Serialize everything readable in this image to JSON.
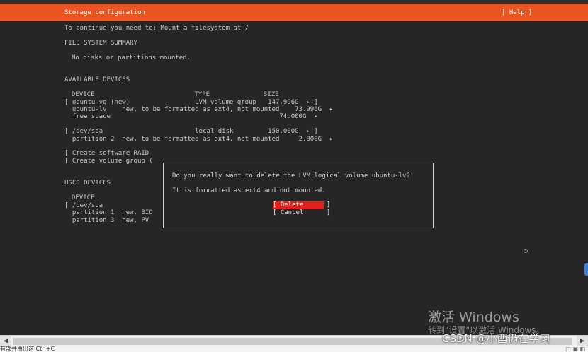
{
  "header": {
    "title": "Storage configuration",
    "help": "[ Help ]"
  },
  "intro": "To continue you need to: Mount a filesystem at /",
  "summary": {
    "heading": "FILE SYSTEM SUMMARY",
    "empty": "No disks or partitions mounted."
  },
  "available": {
    "heading": "AVAILABLE DEVICES",
    "columns": "DEVICE                          TYPE              SIZE",
    "rows": [
      "[ ubuntu-vg (new)                 LVM volume group   147.996G  ▸ ]",
      "  ubuntu-lv    new, to be formatted as ext4, not mounted    73.996G  ▸",
      "  free space                                            74.000G  ▸",
      "[ /dev/sda                        local disk         150.000G  ▸ ]",
      "  partition 2  new, to be formatted as ext4, not mounted     2.000G  ▸"
    ],
    "actions": [
      "[ Create software RAID",
      "[ Create volume group ("
    ]
  },
  "used": {
    "heading": "USED DEVICES",
    "columns": "DEVICE",
    "rows": [
      "[ /dev/sda",
      "  partition 1  new, BIO",
      "  partition 3  new, PV"
    ]
  },
  "dialog": {
    "question": "Do you really want to delete the LVM logical volume ubuntu-lv?",
    "detail": "It is formatted as ext4 and not mounted.",
    "delete_label": "[ Delete      ]",
    "cancel_label": "[ Cancel      ]"
  },
  "watermark": {
    "activate": "激活 Windows",
    "hint": "转到\"设置\"以激活 Windows。",
    "csdn": "CSDN @小酉仍在学习"
  },
  "statusbar": {
    "text": "有部并由出这 Ctrl+C"
  },
  "colors": {
    "header": "#e95420",
    "terminal_bg": "#262626",
    "delete_btn": "#e0201b"
  }
}
